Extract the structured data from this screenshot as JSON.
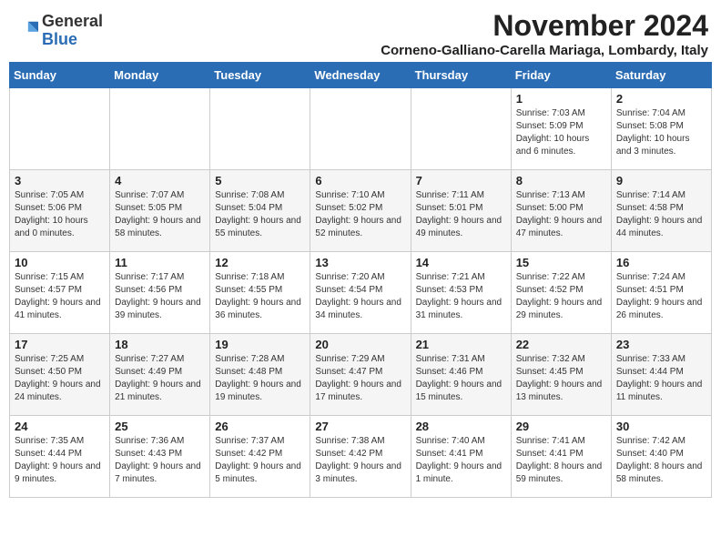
{
  "header": {
    "logo_general": "General",
    "logo_blue": "Blue",
    "month_title": "November 2024",
    "location": "Corneno-Galliano-Carella Mariaga, Lombardy, Italy"
  },
  "days_of_week": [
    "Sunday",
    "Monday",
    "Tuesday",
    "Wednesday",
    "Thursday",
    "Friday",
    "Saturday"
  ],
  "weeks": [
    [
      {
        "day": "",
        "info": ""
      },
      {
        "day": "",
        "info": ""
      },
      {
        "day": "",
        "info": ""
      },
      {
        "day": "",
        "info": ""
      },
      {
        "day": "",
        "info": ""
      },
      {
        "day": "1",
        "info": "Sunrise: 7:03 AM\nSunset: 5:09 PM\nDaylight: 10 hours and 6 minutes."
      },
      {
        "day": "2",
        "info": "Sunrise: 7:04 AM\nSunset: 5:08 PM\nDaylight: 10 hours and 3 minutes."
      }
    ],
    [
      {
        "day": "3",
        "info": "Sunrise: 7:05 AM\nSunset: 5:06 PM\nDaylight: 10 hours and 0 minutes."
      },
      {
        "day": "4",
        "info": "Sunrise: 7:07 AM\nSunset: 5:05 PM\nDaylight: 9 hours and 58 minutes."
      },
      {
        "day": "5",
        "info": "Sunrise: 7:08 AM\nSunset: 5:04 PM\nDaylight: 9 hours and 55 minutes."
      },
      {
        "day": "6",
        "info": "Sunrise: 7:10 AM\nSunset: 5:02 PM\nDaylight: 9 hours and 52 minutes."
      },
      {
        "day": "7",
        "info": "Sunrise: 7:11 AM\nSunset: 5:01 PM\nDaylight: 9 hours and 49 minutes."
      },
      {
        "day": "8",
        "info": "Sunrise: 7:13 AM\nSunset: 5:00 PM\nDaylight: 9 hours and 47 minutes."
      },
      {
        "day": "9",
        "info": "Sunrise: 7:14 AM\nSunset: 4:58 PM\nDaylight: 9 hours and 44 minutes."
      }
    ],
    [
      {
        "day": "10",
        "info": "Sunrise: 7:15 AM\nSunset: 4:57 PM\nDaylight: 9 hours and 41 minutes."
      },
      {
        "day": "11",
        "info": "Sunrise: 7:17 AM\nSunset: 4:56 PM\nDaylight: 9 hours and 39 minutes."
      },
      {
        "day": "12",
        "info": "Sunrise: 7:18 AM\nSunset: 4:55 PM\nDaylight: 9 hours and 36 minutes."
      },
      {
        "day": "13",
        "info": "Sunrise: 7:20 AM\nSunset: 4:54 PM\nDaylight: 9 hours and 34 minutes."
      },
      {
        "day": "14",
        "info": "Sunrise: 7:21 AM\nSunset: 4:53 PM\nDaylight: 9 hours and 31 minutes."
      },
      {
        "day": "15",
        "info": "Sunrise: 7:22 AM\nSunset: 4:52 PM\nDaylight: 9 hours and 29 minutes."
      },
      {
        "day": "16",
        "info": "Sunrise: 7:24 AM\nSunset: 4:51 PM\nDaylight: 9 hours and 26 minutes."
      }
    ],
    [
      {
        "day": "17",
        "info": "Sunrise: 7:25 AM\nSunset: 4:50 PM\nDaylight: 9 hours and 24 minutes."
      },
      {
        "day": "18",
        "info": "Sunrise: 7:27 AM\nSunset: 4:49 PM\nDaylight: 9 hours and 21 minutes."
      },
      {
        "day": "19",
        "info": "Sunrise: 7:28 AM\nSunset: 4:48 PM\nDaylight: 9 hours and 19 minutes."
      },
      {
        "day": "20",
        "info": "Sunrise: 7:29 AM\nSunset: 4:47 PM\nDaylight: 9 hours and 17 minutes."
      },
      {
        "day": "21",
        "info": "Sunrise: 7:31 AM\nSunset: 4:46 PM\nDaylight: 9 hours and 15 minutes."
      },
      {
        "day": "22",
        "info": "Sunrise: 7:32 AM\nSunset: 4:45 PM\nDaylight: 9 hours and 13 minutes."
      },
      {
        "day": "23",
        "info": "Sunrise: 7:33 AM\nSunset: 4:44 PM\nDaylight: 9 hours and 11 minutes."
      }
    ],
    [
      {
        "day": "24",
        "info": "Sunrise: 7:35 AM\nSunset: 4:44 PM\nDaylight: 9 hours and 9 minutes."
      },
      {
        "day": "25",
        "info": "Sunrise: 7:36 AM\nSunset: 4:43 PM\nDaylight: 9 hours and 7 minutes."
      },
      {
        "day": "26",
        "info": "Sunrise: 7:37 AM\nSunset: 4:42 PM\nDaylight: 9 hours and 5 minutes."
      },
      {
        "day": "27",
        "info": "Sunrise: 7:38 AM\nSunset: 4:42 PM\nDaylight: 9 hours and 3 minutes."
      },
      {
        "day": "28",
        "info": "Sunrise: 7:40 AM\nSunset: 4:41 PM\nDaylight: 9 hours and 1 minute."
      },
      {
        "day": "29",
        "info": "Sunrise: 7:41 AM\nSunset: 4:41 PM\nDaylight: 8 hours and 59 minutes."
      },
      {
        "day": "30",
        "info": "Sunrise: 7:42 AM\nSunset: 4:40 PM\nDaylight: 8 hours and 58 minutes."
      }
    ]
  ]
}
